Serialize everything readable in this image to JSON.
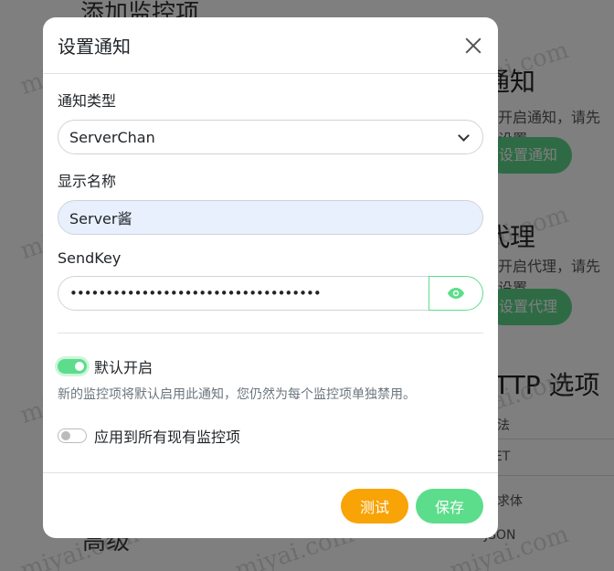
{
  "background": {
    "title": "添加监控项",
    "heading_1": "通知",
    "text_1": "开启通知，请先设置",
    "button_1": "设置通知",
    "heading_2": "代理",
    "text_2": "开启代理，请先设置",
    "button_2": "设置代理",
    "heading_3": "HTTP 选项",
    "row_1": "方法",
    "row_2": "GET",
    "row_3": "请求体",
    "row_4": "JSON",
    "bottom_text": "高级",
    "watermark": "miyai.com"
  },
  "modal": {
    "title": "设置通知",
    "notification_type": {
      "label": "通知类型",
      "value": "ServerChan"
    },
    "display_name": {
      "label": "显示名称",
      "value": "Server酱"
    },
    "sendkey": {
      "label": "SendKey",
      "value": "•••••••••••••••••••••••••••••••••••"
    },
    "default_enabled": {
      "label": "默认开启",
      "checked": true,
      "help": "新的监控项将默认启用此通知，您仍然为每个监控项单独禁用。"
    },
    "apply_existing": {
      "label": "应用到所有现有监控项",
      "checked": false
    },
    "buttons": {
      "test": "测试",
      "save": "保存"
    }
  },
  "colors": {
    "accent_green": "#5cdd8b",
    "warning_orange": "#f8a306"
  }
}
